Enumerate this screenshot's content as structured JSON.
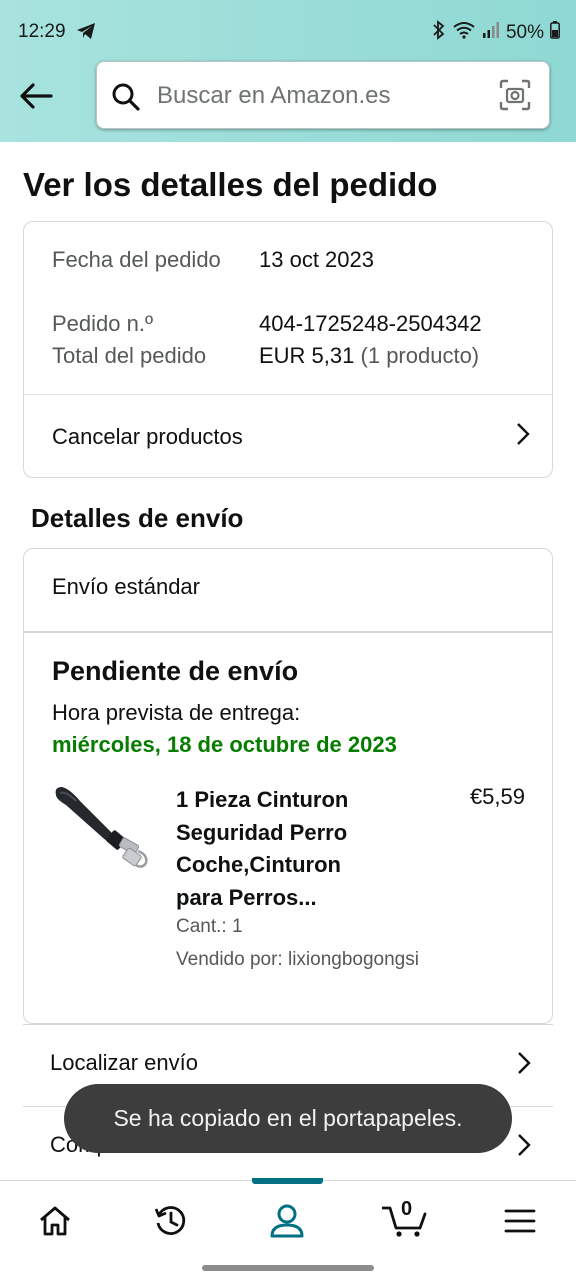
{
  "status_bar": {
    "time": "12:29",
    "battery": "50%"
  },
  "search": {
    "placeholder": "Buscar en Amazon.es"
  },
  "page": {
    "title": "Ver los detalles del pedido"
  },
  "order_info": {
    "date_label": "Fecha del pedido",
    "date_value": "13 oct 2023",
    "number_label": "Pedido n.º",
    "number_value": "404-1725248-2504342",
    "total_label": "Total del pedido",
    "total_value": "EUR 5,31",
    "total_count": "(1 producto)",
    "cancel_label": "Cancelar productos"
  },
  "shipping": {
    "section_title": "Detalles de envío",
    "method": "Envío estándar",
    "status": "Pendiente de envío",
    "delivery_label": "Hora prevista de entrega:",
    "delivery_date": "miércoles, 18 de octubre de 2023"
  },
  "product": {
    "title": "1 Pieza Cinturon Seguridad Perro Coche,Cinturon para Perros...",
    "price": "€5,59",
    "quantity": "Cant.: 1",
    "seller": "Vendido por: lixiongbogongsi"
  },
  "actions": {
    "track": "Localizar envío",
    "buy_again": "Comprarlo de nuevo"
  },
  "toast": {
    "message": "Se ha copiado en el portapapeles."
  },
  "nav": {
    "cart_count": "0",
    "active": "account",
    "accent_color": "#007185"
  },
  "colors": {
    "header": "#a8e3de",
    "delivery_green": "#067d00"
  }
}
